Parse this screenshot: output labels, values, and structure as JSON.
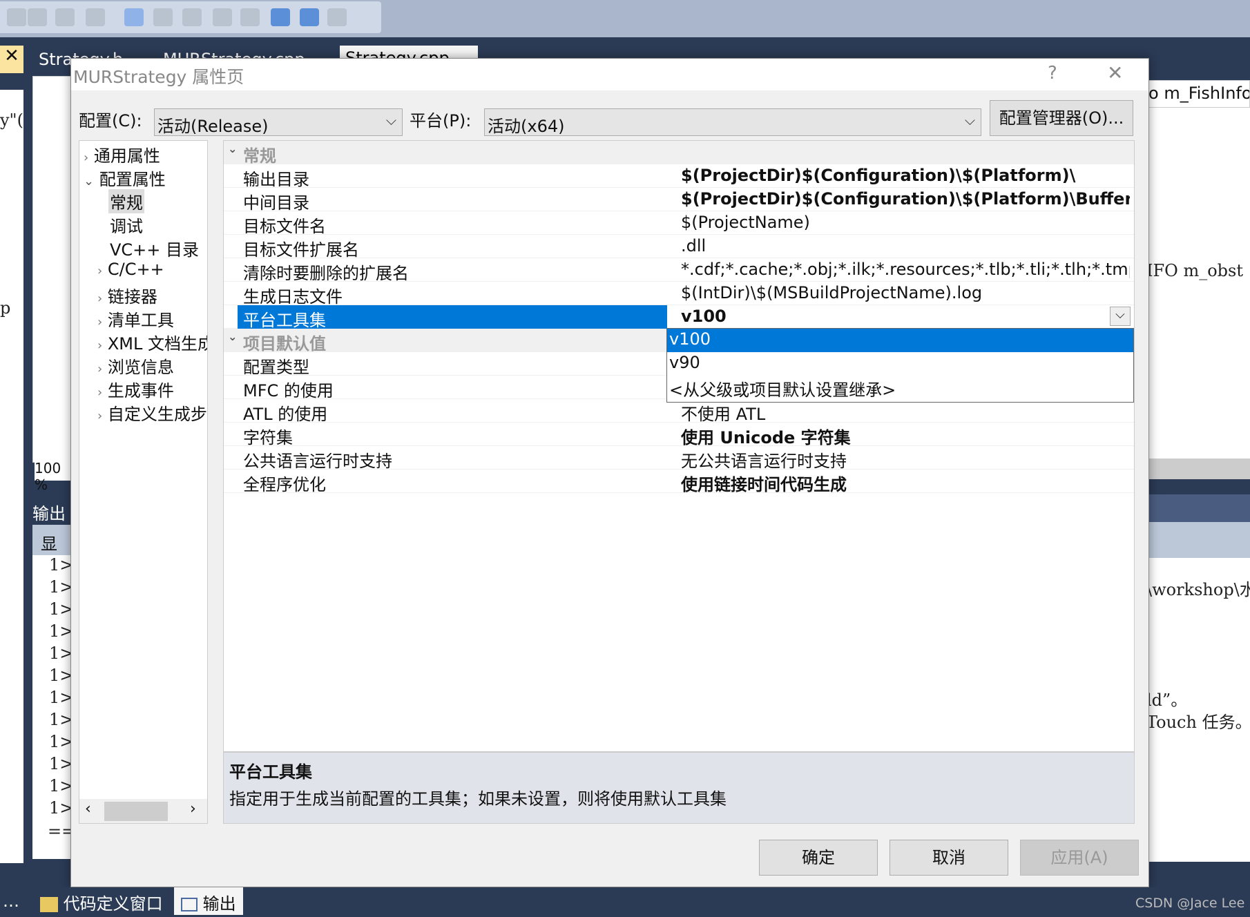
{
  "ide": {
    "tabs": [
      "Strategy.h",
      "MURStrategy.cpp",
      "Strategy.cpp"
    ],
    "code_fragments": [
      "o m_FishInfo[",
      "IFO m_obst",
      "\\workshop\\水",
      "ld”。",
      "Touch 任务。",
      "y\"(",
      "p"
    ],
    "zoom": "100 %",
    "output_title": "输出",
    "output_show": "显示",
    "output_lines": [
      "1>",
      "1>",
      "1>",
      "1>",
      "1>",
      "1>",
      "1>",
      "1>",
      "1>",
      "1>",
      "1>",
      "1>"
    ],
    "separator": "==",
    "taskbar": [
      {
        "icon": "code-definition-icon",
        "label": "代码定义窗口"
      },
      {
        "icon": "output-icon",
        "label": "输出"
      }
    ],
    "watermark": "CSDN @Jace Lee"
  },
  "dialog": {
    "title": "MURStrategy 属性页",
    "help": "?",
    "close": "✕",
    "config_label": "配置(C):",
    "config_value": "活动(Release)",
    "platform_label": "平台(P):",
    "platform_value": "活动(x64)",
    "config_manager": "配置管理器(O)...",
    "tree": [
      {
        "label": "通用属性",
        "arrow": "›",
        "level": 0
      },
      {
        "label": "配置属性",
        "arrow": "⌄",
        "level": 0
      },
      {
        "label": "常规",
        "level": 1,
        "selected": true
      },
      {
        "label": "调试",
        "level": 1
      },
      {
        "label": "VC++ 目录",
        "level": 1
      },
      {
        "label": "C/C++",
        "arrow": "›",
        "level": 1
      },
      {
        "label": "链接器",
        "arrow": "›",
        "level": 1
      },
      {
        "label": "清单工具",
        "arrow": "›",
        "level": 1
      },
      {
        "label": "XML 文档生成器",
        "arrow": "›",
        "level": 1
      },
      {
        "label": "浏览信息",
        "arrow": "›",
        "level": 1
      },
      {
        "label": "生成事件",
        "arrow": "›",
        "level": 1
      },
      {
        "label": "自定义生成步骤",
        "arrow": "›",
        "level": 1
      }
    ],
    "rows": [
      {
        "header": true,
        "name": "常规"
      },
      {
        "name": "输出目录",
        "value": "$(ProjectDir)$(Configuration)\\$(Platform)\\",
        "bold": true
      },
      {
        "name": "中间目录",
        "value": "$(ProjectDir)$(Configuration)\\$(Platform)\\Buffer\\",
        "bold": true
      },
      {
        "name": "目标文件名",
        "value": "$(ProjectName)"
      },
      {
        "name": "目标文件扩展名",
        "value": ".dll"
      },
      {
        "name": "清除时要删除的扩展名",
        "value": "*.cdf;*.cache;*.obj;*.ilk;*.resources;*.tlb;*.tli;*.tlh;*.tmp;*.rsp;*"
      },
      {
        "name": "生成日志文件",
        "value": "$(IntDir)\\$(MSBuildProjectName).log"
      },
      {
        "name": "平台工具集",
        "value": "v100",
        "bold": true,
        "selected": true
      },
      {
        "header": true,
        "name": "项目默认值"
      },
      {
        "name": "配置类型",
        "value": ""
      },
      {
        "name": "MFC 的使用",
        "value": ""
      },
      {
        "name": "ATL 的使用",
        "value": "不使用 ATL"
      },
      {
        "name": "字符集",
        "value": "使用 Unicode 字符集",
        "bold": true
      },
      {
        "name": "公共语言运行时支持",
        "value": "无公共语言运行时支持"
      },
      {
        "name": "全程序优化",
        "value": "使用链接时间代码生成",
        "bold": true
      }
    ],
    "dropdown_options": [
      "v100",
      "v90",
      "<从父级或项目默认设置继承>"
    ],
    "dropdown_selected": "v100",
    "desc_title": "平台工具集",
    "desc_text": "指定用于生成当前配置的工具集；如果未设置，则将使用默认工具集",
    "ok": "确定",
    "cancel": "取消",
    "apply": "应用(A)",
    "accent": "#0078d7"
  }
}
